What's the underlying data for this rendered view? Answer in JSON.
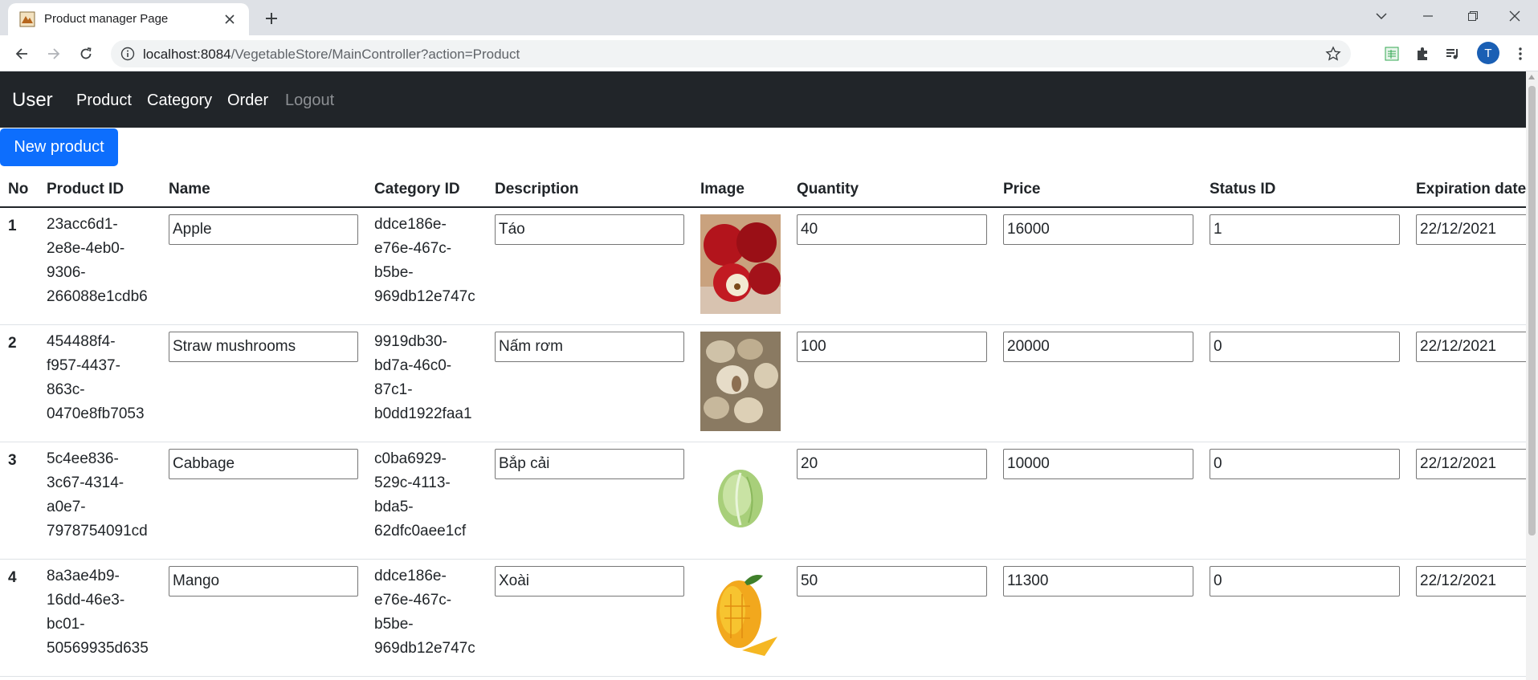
{
  "browser": {
    "tab_title": "Product manager Page",
    "url_host": "localhost:8084",
    "url_path": "/VegetableStore/MainController?action=Product",
    "profile_initial": "T"
  },
  "navbar": {
    "brand": "User",
    "links": [
      "Product",
      "Category",
      "Order",
      "Logout"
    ]
  },
  "actions": {
    "new_product": "New product"
  },
  "table": {
    "headers": [
      "No",
      "Product ID",
      "Name",
      "Category ID",
      "Description",
      "Image",
      "Quantity",
      "Price",
      "Status ID",
      "Expiration date"
    ],
    "rows": [
      {
        "no": "1",
        "product_id": [
          "23acc6d1-",
          "2e8e-4eb0-",
          "9306-",
          "266088e1cdb6"
        ],
        "name": "Apple",
        "category_id": [
          "ddce186e-",
          "e76e-467c-",
          "b5be-",
          "969db12e747c"
        ],
        "description": "Táo",
        "image": "apple-image",
        "quantity": "40",
        "price": "16000",
        "status_id": "1",
        "expiration": "22/12/2021"
      },
      {
        "no": "2",
        "product_id": [
          "454488f4-",
          "f957-4437-",
          "863c-",
          "0470e8fb7053"
        ],
        "name": "Straw mushrooms",
        "category_id": [
          "9919db30-",
          "bd7a-46c0-",
          "87c1-",
          "b0dd1922faa1"
        ],
        "description": "Nấm rơm",
        "image": "mushroom-image",
        "quantity": "100",
        "price": "20000",
        "status_id": "0",
        "expiration": "22/12/2021"
      },
      {
        "no": "3",
        "product_id": [
          "5c4ee836-",
          "3c67-4314-",
          "a0e7-",
          "7978754091cd"
        ],
        "name": "Cabbage",
        "category_id": [
          "c0ba6929-",
          "529c-4113-",
          "bda5-",
          "62dfc0aee1cf"
        ],
        "description": "Bắp cải",
        "image": "cabbage-image",
        "quantity": "20",
        "price": "10000",
        "status_id": "0",
        "expiration": "22/12/2021"
      },
      {
        "no": "4",
        "product_id": [
          "8a3ae4b9-",
          "16dd-46e3-",
          "bc01-",
          "50569935d635"
        ],
        "name": "Mango",
        "category_id": [
          "ddce186e-",
          "e76e-467c-",
          "b5be-",
          "969db12e747c"
        ],
        "description": "Xoài",
        "image": "mango-image",
        "quantity": "50",
        "price": "11300",
        "status_id": "0",
        "expiration": "22/12/2021"
      }
    ]
  }
}
